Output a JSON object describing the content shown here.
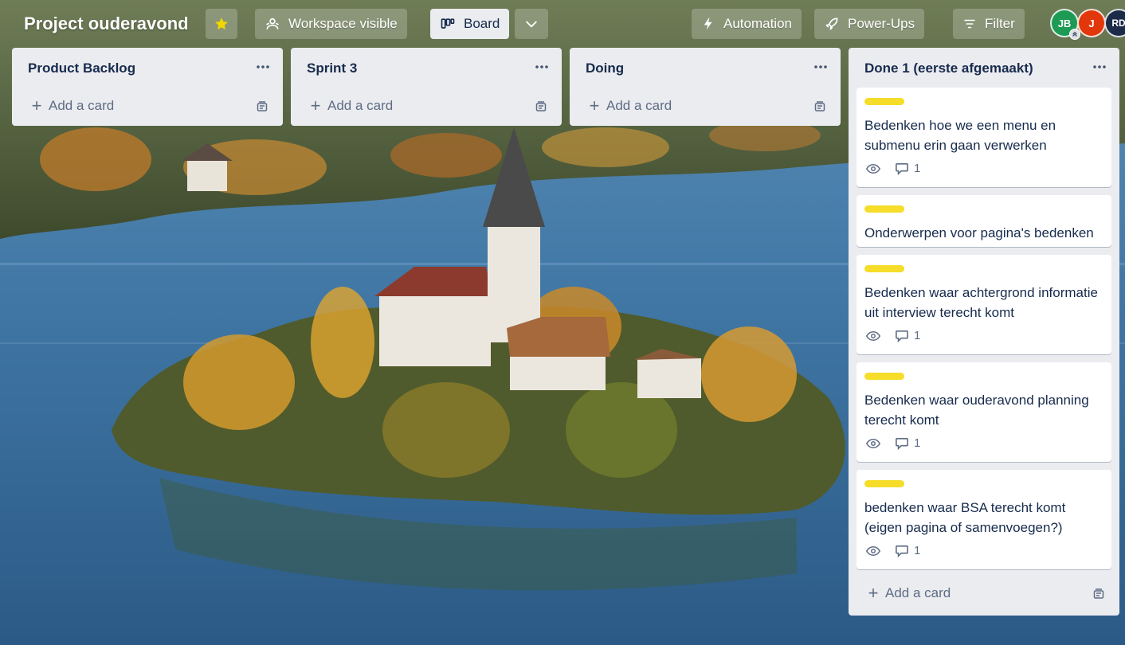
{
  "board": {
    "title": "Project ouderavond",
    "starred": true
  },
  "header": {
    "workspace_visible": "Workspace visible",
    "view_label": "Board",
    "automation": "Automation",
    "power_ups": "Power-Ups",
    "filter": "Filter"
  },
  "members": [
    {
      "initials": "JB",
      "color": "#1d9a54"
    },
    {
      "initials": "J",
      "color": "#e2370b"
    },
    {
      "initials": "RD",
      "color": "#1c2b48"
    }
  ],
  "icons": {
    "star": "star-icon",
    "workspace": "people-icon",
    "board": "board-icon",
    "chevron": "chevron-down-icon",
    "automation": "lightning-icon",
    "power_ups": "rocket-icon",
    "filter": "filter-icon",
    "list_menu": "more-horizontal-icon",
    "template": "card-template-icon",
    "watch": "eye-icon",
    "comments": "comment-icon"
  },
  "colors": {
    "label_yellow": "#f5dd29",
    "list_bg": "#ebecf0",
    "star": "#f2d600"
  },
  "lists": [
    {
      "title": "Product Backlog",
      "add_card": "Add a card"
    },
    {
      "title": "Sprint 3",
      "add_card": "Add a card"
    },
    {
      "title": "Doing",
      "add_card": "Add a card"
    },
    {
      "title": "Done 1 (eerste afgemaakt)",
      "add_card": "Add a card",
      "cards": [
        {
          "title": "Bedenken hoe we een menu en submenu erin gaan verwerken",
          "label": "yellow",
          "watching": true,
          "comments": "1"
        },
        {
          "title": "Onderwerpen voor pagina's bedenken",
          "label": "yellow"
        },
        {
          "title": "Bedenken waar achtergrond informatie uit interview terecht komt",
          "label": "yellow",
          "watching": true,
          "comments": "1"
        },
        {
          "title": "Bedenken waar ouderavond planning terecht komt",
          "label": "yellow",
          "watching": true,
          "comments": "1"
        },
        {
          "title": "bedenken waar BSA terecht komt (eigen pagina of samenvoegen?)",
          "label": "yellow",
          "watching": true,
          "comments": "1"
        }
      ]
    }
  ]
}
